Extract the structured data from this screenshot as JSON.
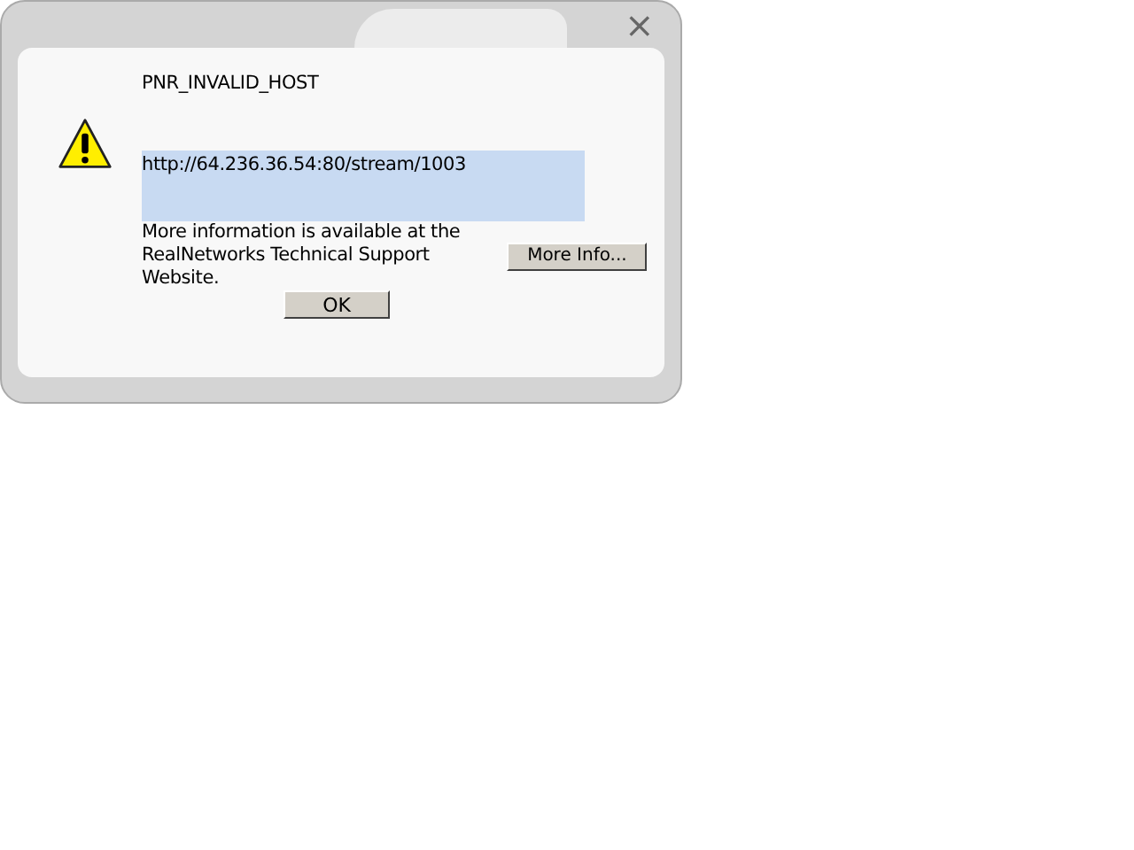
{
  "dialog": {
    "close": "×",
    "error_code": "PNR_INVALID_HOST",
    "url": "http://64.236.36.54:80/stream/1003",
    "message": "More information is available at the RealNetworks Technical Support Website.",
    "buttons": [
      {
        "kind": "more",
        "label": "More Info..."
      },
      {
        "kind": "ok",
        "label": "OK"
      }
    ]
  }
}
